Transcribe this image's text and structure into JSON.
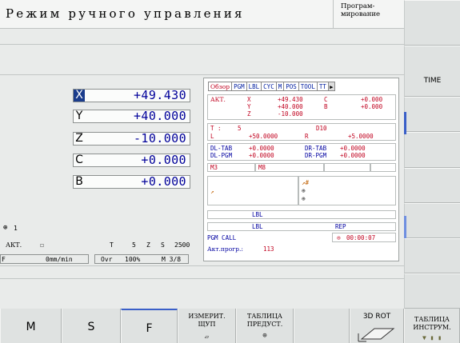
{
  "header": {
    "title": "Режим ручного управления",
    "mode": "Програм-\nмирование"
  },
  "right_softkeys": [
    "",
    "TIME",
    "",
    "",
    "",
    "",
    "",
    ""
  ],
  "positions": [
    {
      "axis": "X",
      "value": "+49.430",
      "active": true
    },
    {
      "axis": "Y",
      "value": "+40.000",
      "active": false
    },
    {
      "axis": "Z",
      "value": "-10.000",
      "active": false
    },
    {
      "axis": "C",
      "value": "+0.000",
      "active": false
    },
    {
      "axis": "B",
      "value": "+0.000",
      "active": false
    }
  ],
  "info": {
    "count": "1",
    "akt": "АКТ.",
    "t_label": "T",
    "t_value": "5",
    "z_label": "Z",
    "s_label": "S",
    "s_value": "2500",
    "f_label": "F",
    "f_value": "0mm/min",
    "ovr_label": "Ovr",
    "ovr_value": "100%",
    "m_value": "M 3/8"
  },
  "status": {
    "tabs": [
      "Обзор",
      "PGM",
      "LBL",
      "CYC",
      "M",
      "POS",
      "TOOL",
      "TT"
    ],
    "akt": "АКТ.",
    "coords": [
      {
        "axis": "X",
        "value": "+49.430",
        "axis2": "C",
        "value2": "+0.000"
      },
      {
        "axis": "Y",
        "value": "+40.000",
        "axis2": "B",
        "value2": "+0.000"
      },
      {
        "axis": "Z",
        "value": "-10.000",
        "axis2": "",
        "value2": ""
      }
    ],
    "t_label": "T :",
    "t_value": "5",
    "d_value": "D10",
    "l_label": "L",
    "l_value": "+50.0000",
    "r_label": "R",
    "r_value": "+5.0000",
    "dl_tab": "DL-TAB",
    "dl_tab_v": "+0.0000",
    "dr_tab": "DR-TAB",
    "dr_tab_v": "+0.0000",
    "dl_pgm": "DL-PGM",
    "dl_pgm_v": "+0.0000",
    "dr_pgm": "DR-PGM",
    "dr_pgm_v": "+0.0000",
    "m3": "M3",
    "m8": "M8",
    "lbl1": "LBL",
    "lbl2": "LBL",
    "rep": "REP",
    "pgm_call": "PGM CALL",
    "time": "00:00:07",
    "akt_prog": "Акт.прогр.:",
    "akt_prog_value": "113"
  },
  "bottom_softkeys": [
    {
      "label": "M"
    },
    {
      "label": "S"
    },
    {
      "label": "F"
    },
    {
      "label": "ИЗМЕРИТ.\nЩУП"
    },
    {
      "label": "ТАБЛИЦА\nПРЕДУСТ."
    },
    {
      "label": ""
    },
    {
      "label": "3D ROT"
    },
    {
      "label": "ТАБЛИЦА\nИНСТРУМ."
    }
  ],
  "colors": {
    "background": "#e9ebea",
    "active_axis": "#1a3c8c",
    "value_blue": "#00009a",
    "tab_red": "#c0001e",
    "scroll_marker": "#3a5fc8"
  }
}
